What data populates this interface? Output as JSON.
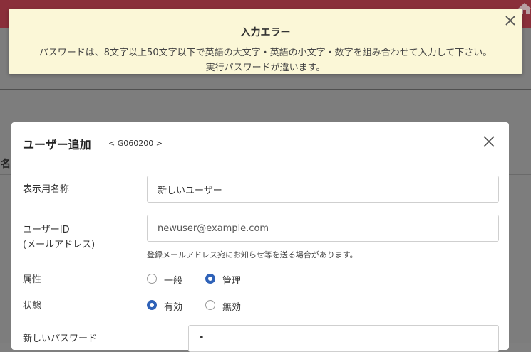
{
  "toast": {
    "title": "入力エラー",
    "line1": "パスワードは、8文字以上50文字以下で英語の大文字・英語の小文字・数字を組み合わせて入力して下さい。",
    "line2": "実行パスワードが違います。"
  },
  "background": {
    "column_label": "名"
  },
  "modal": {
    "title": "ユーザー追加",
    "screen_code": "< G060200 >",
    "fields": {
      "display_name": {
        "label": "表示用名称",
        "value": "新しいユーザー"
      },
      "user_id": {
        "label_line1": "ユーザーID",
        "label_line2": "(メールアドレス)",
        "placeholder": "newuser@example.com",
        "help": "登録メールアドレス宛にお知らせ等を送る場合があります。"
      },
      "attribute": {
        "label": "属性",
        "options": [
          "一般",
          "管理"
        ],
        "selected": "管理"
      },
      "status": {
        "label": "状態",
        "options": [
          "有効",
          "無効"
        ],
        "selected": "有効"
      },
      "new_password": {
        "label": "新しいパスワード",
        "value": "•"
      }
    }
  },
  "colors": {
    "header": "#8a2f3a",
    "toast_bg": "#fbf7d7",
    "radio_accent": "#2f62b8"
  }
}
